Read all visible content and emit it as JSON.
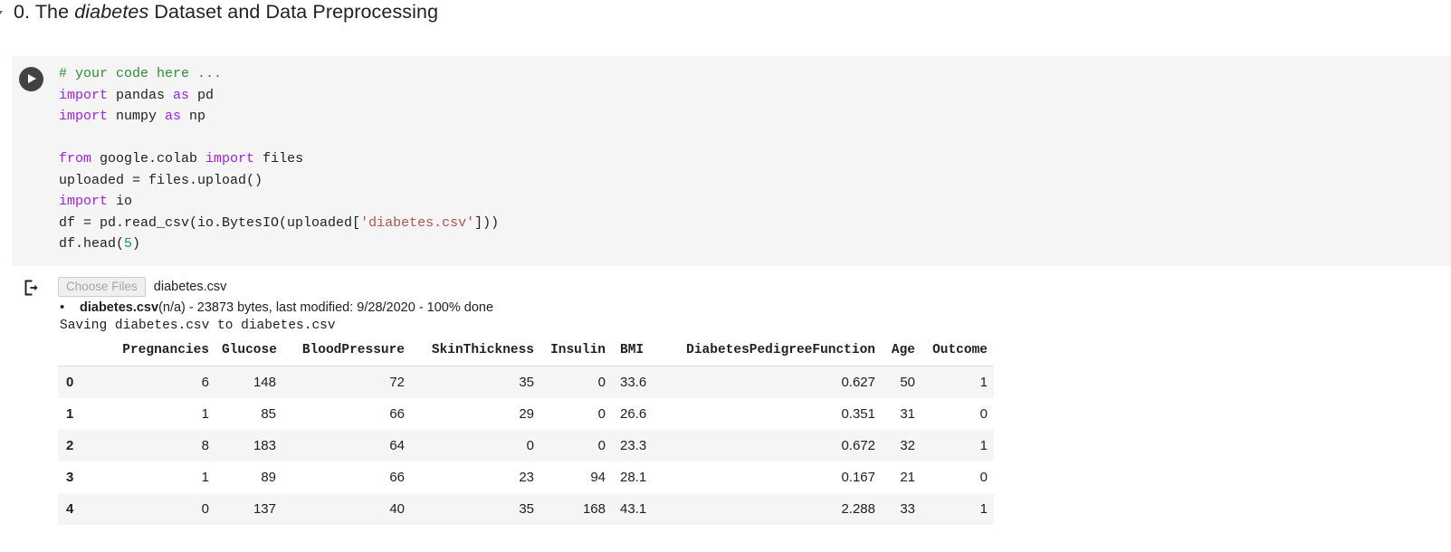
{
  "heading": {
    "prefix": "0. The ",
    "italic_word": "diabetes",
    "suffix": " Dataset and Data Preprocessing",
    "collapse_icon": "triangle-down-icon"
  },
  "code_cell": {
    "run_icon": "play-icon",
    "lines": [
      "# your code here ...",
      "import pandas as pd",
      "import numpy as np",
      "",
      "from google.colab import files",
      "uploaded = files.upload()",
      "import io",
      "df = pd.read_csv(io.BytesIO(uploaded['diabetes.csv']))",
      "df.head(5)"
    ],
    "colors": {
      "keyword": "#a020f0",
      "comment": "#2f8f2f",
      "string": "#b5524a",
      "number": "#1a8a8a",
      "background": "#f5f5f5"
    }
  },
  "output": {
    "output_icon": "output-arrow-icon",
    "choose_files_label": "Choose Files",
    "selected_filename": "diabetes.csv",
    "upload_status": {
      "filename": "diabetes.csv",
      "size_note": "(n/a) - 23873 bytes, last modified: 9/28/2020 - 100% done"
    },
    "saving_line": "Saving diabetes.csv to diabetes.csv"
  },
  "dataframe": {
    "columns": [
      "Pregnancies",
      "Glucose",
      "BloodPressure",
      "SkinThickness",
      "Insulin",
      "BMI",
      "DiabetesPedigreeFunction",
      "Age",
      "Outcome"
    ],
    "rows": [
      {
        "index": "0",
        "Pregnancies": "6",
        "Glucose": "148",
        "BloodPressure": "72",
        "SkinThickness": "35",
        "Insulin": "0",
        "BMI": "33.6",
        "DiabetesPedigreeFunction": "0.627",
        "Age": "50",
        "Outcome": "1"
      },
      {
        "index": "1",
        "Pregnancies": "1",
        "Glucose": "85",
        "BloodPressure": "66",
        "SkinThickness": "29",
        "Insulin": "0",
        "BMI": "26.6",
        "DiabetesPedigreeFunction": "0.351",
        "Age": "31",
        "Outcome": "0"
      },
      {
        "index": "2",
        "Pregnancies": "8",
        "Glucose": "183",
        "BloodPressure": "64",
        "SkinThickness": "0",
        "Insulin": "0",
        "BMI": "23.3",
        "DiabetesPedigreeFunction": "0.672",
        "Age": "32",
        "Outcome": "1"
      },
      {
        "index": "3",
        "Pregnancies": "1",
        "Glucose": "89",
        "BloodPressure": "66",
        "SkinThickness": "23",
        "Insulin": "94",
        "BMI": "28.1",
        "DiabetesPedigreeFunction": "0.167",
        "Age": "21",
        "Outcome": "0"
      },
      {
        "index": "4",
        "Pregnancies": "0",
        "Glucose": "137",
        "BloodPressure": "40",
        "SkinThickness": "35",
        "Insulin": "168",
        "BMI": "43.1",
        "DiabetesPedigreeFunction": "2.288",
        "Age": "33",
        "Outcome": "1"
      }
    ]
  }
}
